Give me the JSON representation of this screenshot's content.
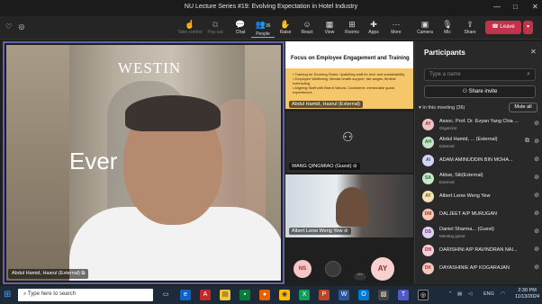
{
  "window": {
    "title": "NU Lecture Series #19: Evolving Expectation in Hotel Industry",
    "min": "—",
    "max": "□",
    "close": "✕"
  },
  "toolbar": {
    "left_icons": [
      "♡",
      "◎"
    ],
    "take_control": "Take control",
    "pop_out": "Pop out",
    "chat": "Chat",
    "people": "People",
    "people_count": "36",
    "raise": "Raise",
    "react": "React",
    "view": "View",
    "rooms": "Rooms",
    "apps": "Apps",
    "more": "More",
    "camera": "Camera",
    "mic": "Mic",
    "share": "Share",
    "leave": "Leave"
  },
  "main_video": {
    "brand": "WESTIN",
    "tagline": "Ever",
    "name": "Abdul Hamid, Hasrul (External)"
  },
  "tiles": {
    "slide": {
      "title": "Focus on Employee Engagement and Training",
      "bullets": [
        "• Training for Evolving Roles: Upskilling staff for tech and sustainability",
        "• Employee Wellbeing: Mental health support, fair wages, flexible scheduling",
        "• Aligning Staff with Brand Values: Consistent, memorable guest experiences"
      ],
      "name": "Abdul Hamid, Hasrul (External)"
    },
    "guest": {
      "name": "WANG QINGMIAO (Guest)"
    },
    "camera": {
      "name": "Albert Leow Weng Yew"
    },
    "avatars": {
      "ns": "NS",
      "ay": "AY",
      "more": "···"
    }
  },
  "panel": {
    "title": "Participants",
    "close": "✕",
    "search_placeholder": "Type a name",
    "share_invite": "Share invite",
    "in_meeting": "In this meeting (36)",
    "mute_all": "Mute all",
    "participants": [
      {
        "initials": "AY",
        "name": "Assoc. Prof. Dr. Evyan Yang Chia ...",
        "sub": "Organizer",
        "color": "#f2c1c1",
        "text": "#a03030"
      },
      {
        "initials": "AH",
        "name": "Abdul Hamid, ...   (External)",
        "sub": "External",
        "color": "#c7e3c7",
        "text": "#2f6b2f"
      },
      {
        "initials": "AI",
        "name": "ADAM AMINUDDIN BIN MOHA...",
        "sub": "",
        "color": "#d3d6f3",
        "text": "#3c4396"
      },
      {
        "initials": "SA",
        "name": "Akbar, Siti(External)",
        "sub": "External",
        "color": "#c8e6c9",
        "text": "#2e6b32"
      },
      {
        "initials": "AY",
        "name": "Albert Leow Weng Yew",
        "sub": "",
        "color": "#f4e3b5",
        "text": "#7b5a11"
      },
      {
        "initials": "DM",
        "name": "DALJEET A/P MURUGAN",
        "sub": "",
        "color": "#f5c9b8",
        "text": "#9a3b1c"
      },
      {
        "initials": "DS",
        "name": "Daniel Sharma...   (Guest)",
        "sub": "Meeting guest",
        "color": "#e2d1ef",
        "text": "#5f3c83"
      },
      {
        "initials": "DN",
        "name": "DARISHINI A/P RAVINDRAN NAI...",
        "sub": "",
        "color": "#f8d0d8",
        "text": "#9b2b45"
      },
      {
        "initials": "DK",
        "name": "DAYASHINIE A/P KOGARAJAN",
        "sub": "",
        "color": "#f6c7c0",
        "text": "#a13a2c"
      }
    ]
  },
  "taskbar": {
    "search": "Type here to search",
    "lang": "ENG",
    "time": "2:30 PM",
    "date": "11/13/2024"
  },
  "icons": {
    "camera": "camera-icon",
    "mic": "mic-icon",
    "share": "share-icon"
  }
}
